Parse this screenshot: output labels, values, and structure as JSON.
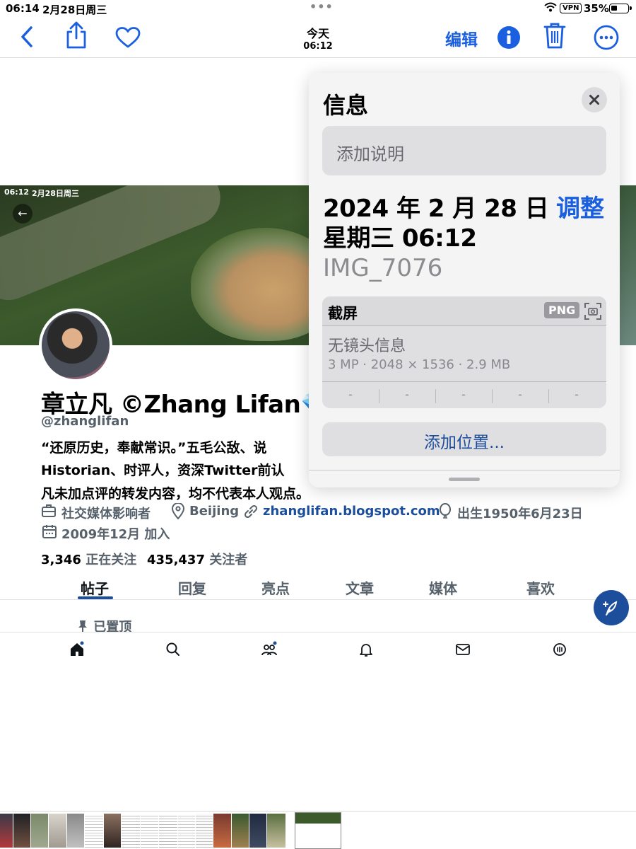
{
  "status_bar": {
    "time": "06:14",
    "date": "2月28日周三",
    "vpn": "VPN",
    "battery": "35%"
  },
  "toolbar": {
    "date_label": "今天",
    "time_label": "06:12",
    "edit_label": "编辑"
  },
  "screenshot": {
    "banner_time": "06:12",
    "banner_date": "2月28日周三",
    "profile": {
      "name": "章立凡 ©Zhang Lifan",
      "handle": "@zhanglifan",
      "bio_lines": [
        "“还原历史，奉献常识。”五毛公敌、说",
        "Historian、时评人，资深Twitter前认",
        "凡未加点评的转发内容，均不代表本人观点。"
      ],
      "category": "社交媒体影响者",
      "location": "Beijing",
      "website": "zhanglifan.blogspot.com",
      "birth": "出生1950年6月23日",
      "joined": "2009年12月 加入",
      "following_count": "3,346",
      "following_label": "正在关注",
      "followers_count": "435,437",
      "followers_label": "关注者",
      "tabs": [
        "帖子",
        "回复",
        "亮点",
        "文章",
        "媒体",
        "喜欢"
      ],
      "pinned_label": "已置顶"
    }
  },
  "info_panel": {
    "title": "信息",
    "caption_placeholder": "添加说明",
    "date_line": "2024 年 2 月 28 日",
    "time_line": "星期三 06:12",
    "adjust_label": "调整",
    "filename": "IMG_7076",
    "kind": "截屏",
    "format": "PNG",
    "lens_info": "无镜头信息",
    "specs": "3 MP · 2048 × 1536 · 2.9 MB",
    "exif_values": [
      "-",
      "-",
      "-",
      "-",
      "-"
    ],
    "add_location": "添加位置..."
  },
  "colors": {
    "accent": "#1a5fe0",
    "twitter_blue": "#1d4e9b"
  }
}
